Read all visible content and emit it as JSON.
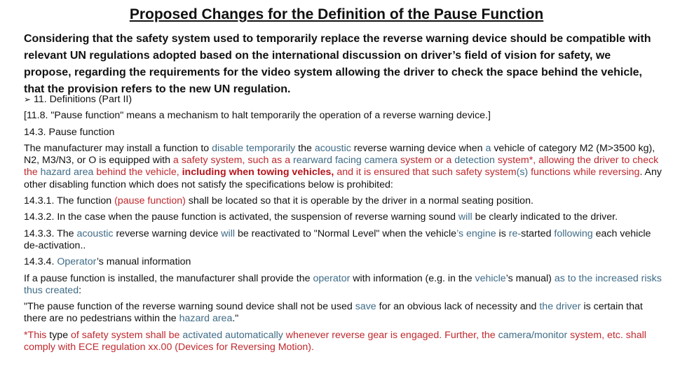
{
  "title": "Proposed Changes for the Definition of the Pause Function",
  "intro": "Considering that the safety system used to temporarily replace the reverse warning device should be compatible with relevant UN regulations adopted based on the international discussion on driver’s field of vision for safety, we propose, regarding the requirements for the video system allowing the driver to check the space behind the vehicle, that the provision refers to the new UN regulation.",
  "colors": {
    "text": "#111111",
    "blue": "#3f6b86",
    "red": "#c0282d",
    "bold_red": "#b5141c"
  },
  "bullet_icon": "➢",
  "heading_11": "11. Definitions (Part II)",
  "def_11_8": "[11.8. \"Pause function\" means a mechanism to halt temporarily the operation of a reverse warning device.]",
  "heading_14_3": "14.3. Pause function",
  "p14_3": {
    "s1": "The manufacturer may install a function to ",
    "s2": "disable temporarily",
    "s3": " the ",
    "s4": "acoustic",
    "s5": " reverse warning device when ",
    "s6": "a",
    "s7": " vehicle of category M2 (M>3500 kg), N2, M3/N3, or O is equipped with ",
    "s8": "a safety system, such as a ",
    "s9": "rearward facing camera",
    "s10": " system or a ",
    "s11": "detection",
    "s12": " system*, allowing the driver to check the ",
    "s13": "hazard area",
    "s14": " behind the vehicle, ",
    "s15": "including when towing vehicles,",
    "s16": " and it is ensured that such safety system",
    "s17": "(s)",
    "s18": " functions while reversing",
    "s19": ". Any other disabling function which does not satisfy the specifications below is prohibited:"
  },
  "p14_3_1": {
    "s1": "14.3.1. The function ",
    "s2": "(pause function)",
    "s3": " shall be located so that it is operable by the driver in a normal seating position."
  },
  "p14_3_2": {
    "s1": "14.3.2. In the case when the pause function is activated, the suspension of reverse warning sound ",
    "s2": "will",
    "s3": " be clearly indicated to the driver."
  },
  "p14_3_3": {
    "s1": "14.3.3. The ",
    "s2": "acoustic",
    "s3": " reverse warning device ",
    "s4": "will",
    "s5": " be reactivated to \"Normal Level\" when the vehicle",
    "s6": "’s engine",
    "s7": " is ",
    "s8": "re-",
    "s9": "started ",
    "s10": "following",
    "s11": " each vehicle de-activation.."
  },
  "p14_3_4": {
    "s1": "14.3.4.  ",
    "s2": "Operator",
    "s3": "’s manual information"
  },
  "p_manual": {
    "s1": "If a pause function is installed, the manufacturer shall provide the ",
    "s2": "operator",
    "s3": " with information (e.g. in the ",
    "s4": "vehicle",
    "s5": "’s manual) ",
    "s6": "as to the increased risks thus created",
    "s7": ":"
  },
  "p_quote": {
    "s1": "\"The pause function of the reverse warning sound device shall not be used ",
    "s2": "save",
    "s3": " for an obvious lack of necessity and ",
    "s4": "the driver",
    "s5": " is certain that there are no pedestrians within the ",
    "s6": "hazard area",
    "s7": ".\""
  },
  "p_footnote": {
    "s1": "*This ",
    "s2": "type",
    "s3": " of safety system shall be ",
    "s4": "activated automatically",
    "s5": " whenever reverse gear is engaged.   Further, the ",
    "s6": "camera/monitor",
    "s7": " system, etc. shall comply with ECE regulation xx.00 (Devices for Reversing Motion)."
  }
}
